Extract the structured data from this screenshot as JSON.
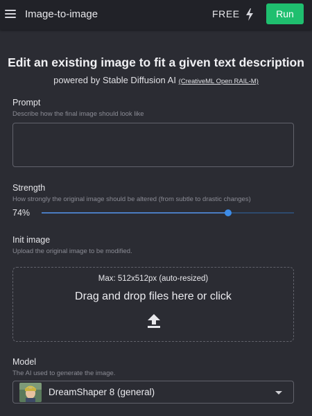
{
  "header": {
    "title": "Image-to-image",
    "plan_label": "FREE",
    "run_label": "Run"
  },
  "intro": {
    "headline": "Edit an existing image to fit a given text description",
    "subline": "powered by Stable Diffusion AI",
    "license_link": "(CreativeML Open RAIL-M)"
  },
  "prompt": {
    "label": "Prompt",
    "description": "Describe how the final image should look like",
    "value": ""
  },
  "strength": {
    "label": "Strength",
    "description": "How strongly the original image should be altered (from subtle to drastic changes)",
    "value_text": "74%",
    "value": 0.74
  },
  "init_image": {
    "label": "Init image",
    "description": "Upload the original image to be modified.",
    "max_text": "Max: 512x512px (auto-resized)",
    "drop_text": "Drag and drop files here or click"
  },
  "model": {
    "label": "Model",
    "description": "The AI used to generate the image.",
    "selected": "DreamShaper 8 (general)"
  },
  "icons": {
    "menu": "hamburger-menu-icon",
    "bolt": "lightning-bolt-icon",
    "upload": "upload-icon",
    "caret": "chevron-down-icon"
  },
  "colors": {
    "run_button": "#1fbf6f",
    "slider_thumb": "#3d8ce8",
    "background": "#2b2c33",
    "topbar": "#212228"
  }
}
